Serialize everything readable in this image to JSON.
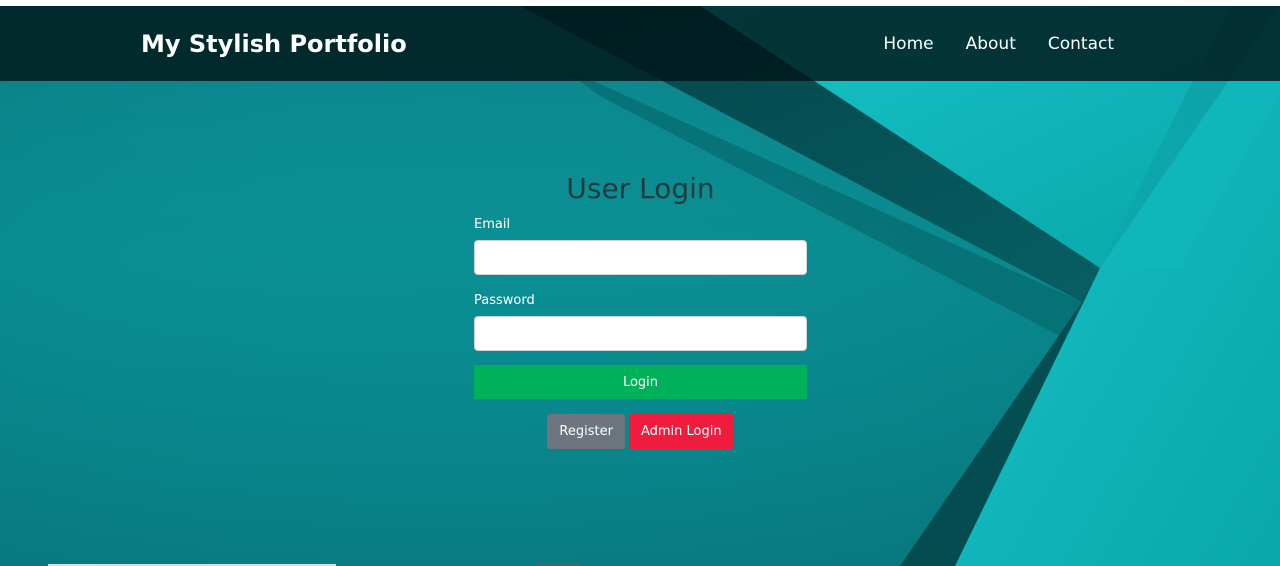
{
  "header": {
    "brand": "My Stylish Portfolio",
    "nav": [
      {
        "label": "Home"
      },
      {
        "label": "About"
      },
      {
        "label": "Contact"
      }
    ]
  },
  "login_form": {
    "title": "User Login",
    "email_label": "Email",
    "email_value": "",
    "password_label": "Password",
    "password_value": "",
    "login_button": "Login",
    "register_button": "Register",
    "admin_login_button": "Admin Login"
  },
  "colors": {
    "background_teal": "#0a8f94",
    "navbar_overlay": "#001618",
    "login_button": "#00b15a",
    "register_button": "#6c757d",
    "admin_button": "#ef1c3d",
    "title_text": "#1d3b3e"
  }
}
